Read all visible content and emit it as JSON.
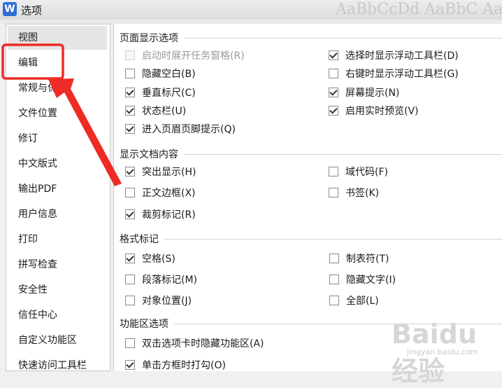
{
  "window": {
    "title": "选项",
    "icon_label": "W",
    "bg_ribbon": "AaBbCcDd  AaBbC  AaBb"
  },
  "sidebar": {
    "items": [
      {
        "label": "视图"
      },
      {
        "label": "编辑"
      },
      {
        "label": "常规与保存"
      },
      {
        "label": "文件位置"
      },
      {
        "label": "修订"
      },
      {
        "label": "中文版式"
      },
      {
        "label": "输出PDF"
      },
      {
        "label": "用户信息"
      },
      {
        "label": "打印"
      },
      {
        "label": "拼写检查"
      },
      {
        "label": "安全性"
      },
      {
        "label": "信任中心"
      },
      {
        "label": "自定义功能区"
      },
      {
        "label": "快速访问工具栏"
      }
    ],
    "selected": "视图"
  },
  "sections": {
    "page_display": {
      "title": "页面显示选项",
      "left": [
        {
          "label": "启动时展开任务窗格(R)",
          "checked": false,
          "disabled": true
        },
        {
          "label": "隐藏空白(B)",
          "checked": false
        },
        {
          "label": "垂直标尺(C)",
          "checked": true
        },
        {
          "label": "状态栏(U)",
          "checked": true
        },
        {
          "label": "进入页眉页脚提示(Q)",
          "checked": true
        }
      ],
      "right": [
        {
          "label": "选择时显示浮动工具栏(D)",
          "checked": true
        },
        {
          "label": "右键时显示浮动工具栏(G)",
          "checked": false
        },
        {
          "label": "屏幕提示(N)",
          "checked": true
        },
        {
          "label": "启用实时预览(V)",
          "checked": true
        }
      ]
    },
    "doc_content": {
      "title": "显示文档内容",
      "left": [
        {
          "label": "突出显示(H)",
          "checked": true
        },
        {
          "label": "正文边框(X)",
          "checked": false
        },
        {
          "label": "裁剪标记(R)",
          "checked": true
        }
      ],
      "right": [
        {
          "label": "域代码(F)",
          "checked": false
        },
        {
          "label": "书签(K)",
          "checked": false
        }
      ]
    },
    "format_marks": {
      "title": "格式标记",
      "left": [
        {
          "label": "空格(S)",
          "checked": true
        },
        {
          "label": "段落标记(M)",
          "checked": false
        },
        {
          "label": "对象位置(J)",
          "checked": false
        }
      ],
      "right": [
        {
          "label": "制表符(T)",
          "checked": false
        },
        {
          "label": "隐藏文字(I)",
          "checked": false
        },
        {
          "label": "全部(L)",
          "checked": false
        }
      ]
    },
    "ribbon": {
      "title": "功能区选项",
      "items": [
        {
          "label": "双击选项卡时隐藏功能区(A)",
          "checked": false
        },
        {
          "label": "单击方框时打勾(O)",
          "checked": true
        }
      ]
    }
  },
  "annotation": {
    "color": "#ee2b24"
  },
  "watermark": {
    "text": "Baidu经验",
    "sub": "jingyan.baidu.com"
  }
}
